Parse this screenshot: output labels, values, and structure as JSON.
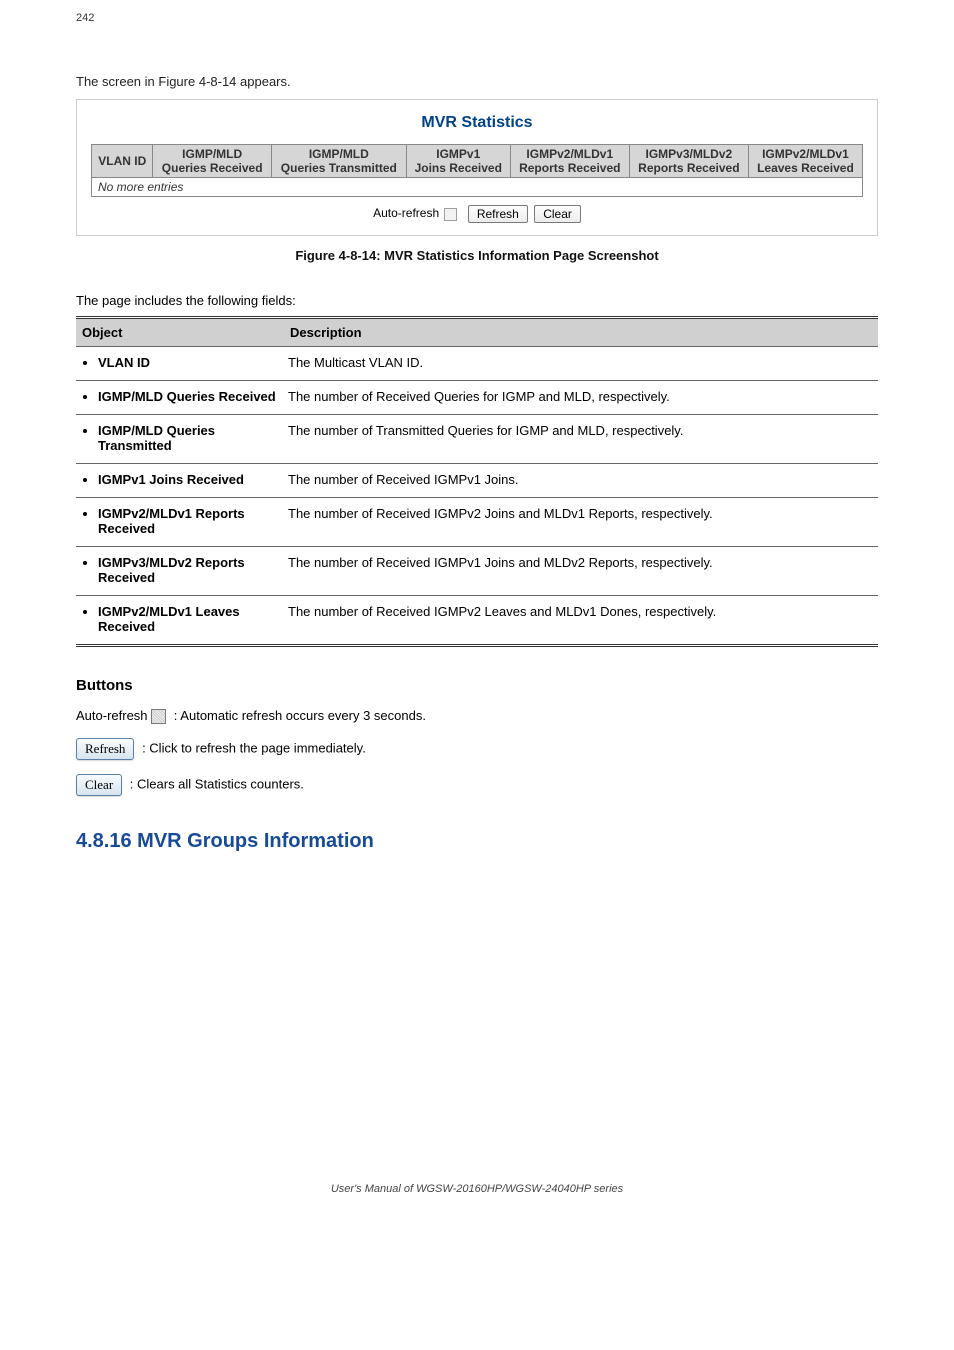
{
  "page_num_top": "242",
  "intro": "The screen in Figure 4-8-14 appears.",
  "figure": {
    "title": "MVR Statistics",
    "headers": [
      {
        "line1": "VLAN ID",
        "line2": ""
      },
      {
        "line1": "IGMP/MLD",
        "line2": "Queries Received"
      },
      {
        "line1": "IGMP/MLD",
        "line2": "Queries Transmitted"
      },
      {
        "line1": "IGMPv1",
        "line2": "Joins Received"
      },
      {
        "line1": "IGMPv2/MLDv1",
        "line2": "Reports Received"
      },
      {
        "line1": "IGMPv3/MLDv2",
        "line2": "Reports Received"
      },
      {
        "line1": "IGMPv2/MLDv1",
        "line2": "Leaves Received"
      }
    ],
    "no_more": "No more entries",
    "auto_refresh_label": "Auto-refresh",
    "refresh_btn": "Refresh",
    "clear_btn": "Clear"
  },
  "figure_caption": "Figure 4-8-14: MVR Statistics Information Page Screenshot",
  "body_text": "The page includes the following fields:",
  "desc": {
    "head_obj": "Object",
    "head_desc": "Description",
    "rows": [
      {
        "obj": "VLAN ID",
        "desc": "The Multicast VLAN ID."
      },
      {
        "obj": "IGMP/MLD Queries Received",
        "desc": "The number of Received Queries for IGMP and MLD, respectively."
      },
      {
        "obj": "IGMP/MLD Queries Transmitted",
        "desc": "The number of Transmitted Queries for IGMP and MLD, respectively."
      },
      {
        "obj": "IGMPv1 Joins Received",
        "desc": "The number of Received IGMPv1 Joins."
      },
      {
        "obj": "IGMPv2/MLDv1 Reports Received",
        "desc": "The number of Received IGMPv2 Joins and MLDv1 Reports, respectively."
      },
      {
        "obj": "IGMPv3/MLDv2 Reports Received",
        "desc": "The number of Received IGMPv1 Joins and MLDv2 Reports, respectively."
      },
      {
        "obj": "IGMPv2/MLDv1 Leaves Received",
        "desc": "The number of Received IGMPv2 Leaves and MLDv1 Dones, respectively."
      }
    ]
  },
  "buttons_heading": "Buttons",
  "auto_refresh_line": {
    "prefix": "Auto-refresh",
    "text": ": Automatic refresh occurs every 3 seconds."
  },
  "refresh_line": {
    "label": "Refresh",
    "text": ": Click to refresh the page immediately."
  },
  "clear_line": {
    "label": "Clear",
    "text": ": Clears all Statistics counters."
  },
  "section_heading": "4.8.16 MVR Groups Information",
  "footer": "User's Manual of WGSW-20160HP/WGSW-24040HP series"
}
